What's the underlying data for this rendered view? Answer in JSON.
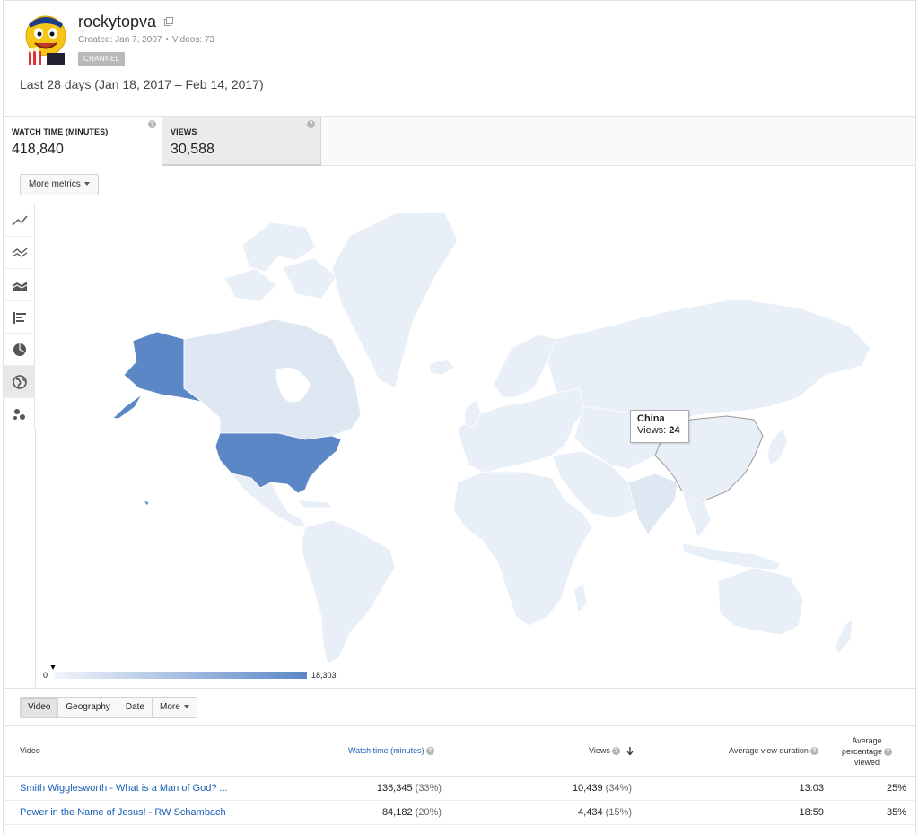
{
  "channel": {
    "name": "rockytopva",
    "created": "Created: Jan 7, 2007",
    "videos": "Videos: 73",
    "badge": "CHANNEL"
  },
  "date_range": "Last 28 days (Jan 18, 2017 – Feb 14, 2017)",
  "metrics": [
    {
      "label": "WATCH TIME (MINUTES)",
      "value": "418,840"
    },
    {
      "label": "VIEWS",
      "value": "30,588"
    }
  ],
  "more_metrics": "More metrics",
  "chart_types": [
    "line-chart-icon",
    "multi-line-icon",
    "stacked-area-icon",
    "bar-chart-icon",
    "pie-chart-icon",
    "globe-icon",
    "bubble-chart-icon"
  ],
  "map": {
    "tooltip": {
      "country": "China",
      "label": "Views:",
      "value": "24"
    },
    "legend_min": "0",
    "legend_max": "18,303",
    "colors": {
      "high": "#5b87c7",
      "mid": "#dfe7f3",
      "low": "#e9eff7",
      "ocean": "#ffffff"
    },
    "highlighted": [
      "United States",
      "Canada",
      "India"
    ]
  },
  "tabs": [
    "Video",
    "Geography",
    "Date",
    "More"
  ],
  "table": {
    "headers": {
      "video": "Video",
      "watch_time": "Watch time (minutes)",
      "views": "Views",
      "avg_duration": "Average view duration",
      "avg_pct_1": "Average",
      "avg_pct_2": "percentage",
      "avg_pct_3": "viewed"
    },
    "rows": [
      {
        "title": "Smith Wigglesworth - What is a Man of God? ...",
        "watch": "136,345",
        "watch_pct": "(33%)",
        "views": "10,439",
        "views_pct": "(34%)",
        "duration": "13:03",
        "pct": "25%"
      },
      {
        "title": "Power in the Name of Jesus! - RW Schambach",
        "watch": "84,182",
        "watch_pct": "(20%)",
        "views": "4,434",
        "views_pct": "(15%)",
        "duration": "18:59",
        "pct": "35%"
      }
    ]
  }
}
